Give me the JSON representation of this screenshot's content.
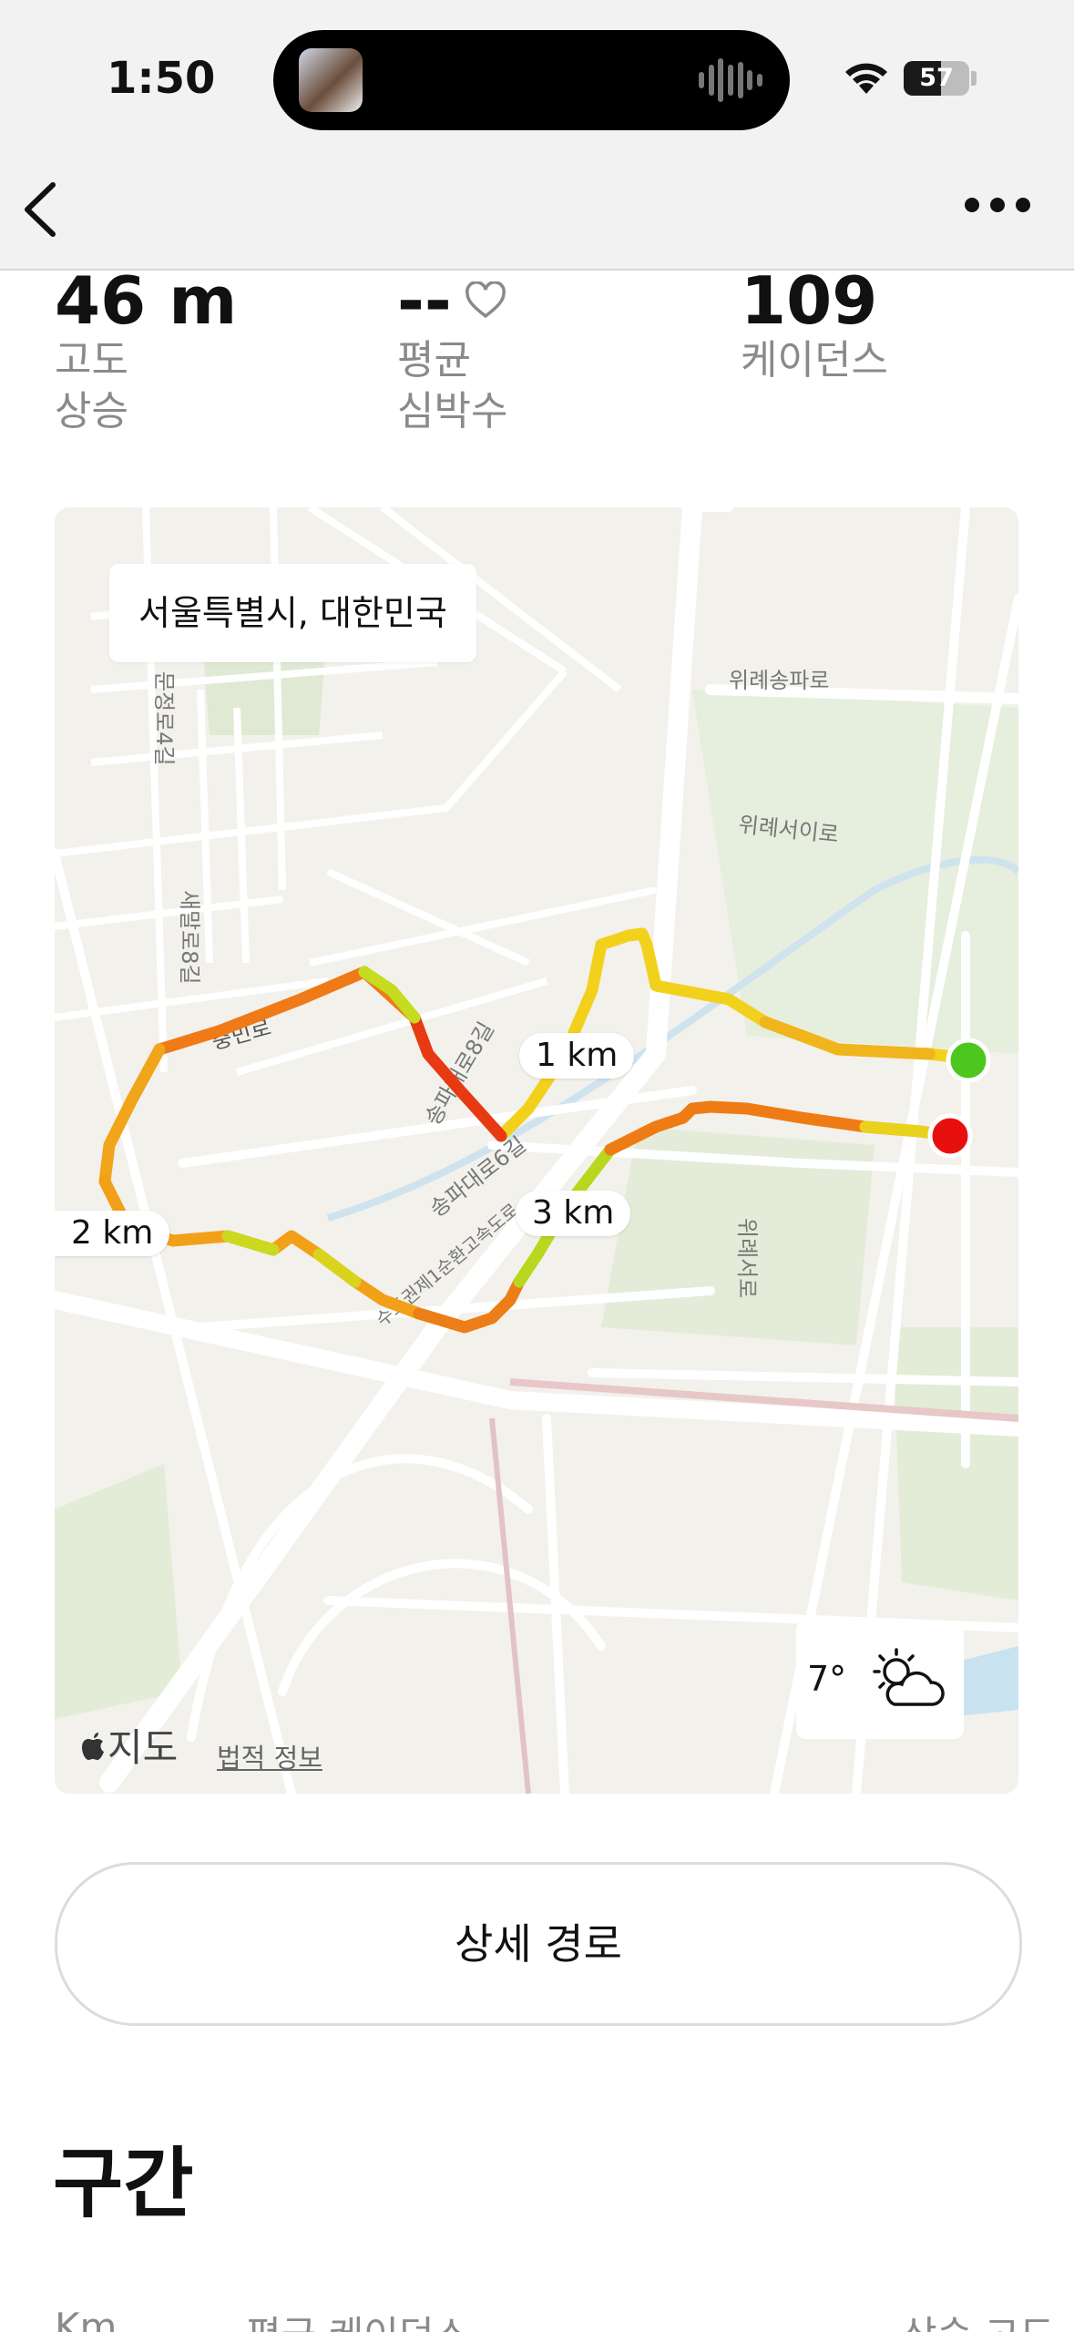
{
  "status_bar": {
    "time": "1:50",
    "battery": "57",
    "battery_level_percent": 57
  },
  "nav": {
    "back_icon": "chevron-left-icon",
    "more_icon": "ellipsis-icon"
  },
  "metrics": [
    {
      "value": "46 m",
      "label": "고도\n상승"
    },
    {
      "value": "--",
      "label": "평균\n심박수",
      "icon": "heart-icon"
    },
    {
      "value": "109",
      "label": "케이던스"
    }
  ],
  "map": {
    "location": "서울특별시, 대한민국",
    "km_markers": [
      "1 km",
      "2 km",
      "3 km"
    ],
    "street_labels": [
      "위례송파로",
      "위례서이로",
      "문정로4길",
      "새말로8길",
      "충민로",
      "송파대로8길",
      "송파대로6길",
      "수도권제1순환고속도로",
      "위례서로"
    ],
    "weather_temp": "7°",
    "weather_icon": "partly-cloudy-icon",
    "maps_brand": "지도",
    "legal": "법적 정보",
    "start_color": "#4cc71f",
    "end_color": "#e8100f"
  },
  "route_button": "상세 경로",
  "section_title": "구간",
  "table_headers": [
    "Km",
    "평균 케이던스",
    "상승 고도"
  ]
}
